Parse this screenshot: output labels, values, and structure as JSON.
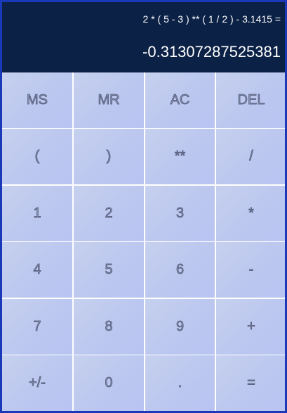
{
  "display": {
    "expression": "2 * ( 5 - 3 ) ** ( 1 / 2 ) - 3.1415 =",
    "result": "-0.31307287525381"
  },
  "keys": [
    {
      "label": "MS",
      "name": "memory-store-button"
    },
    {
      "label": "MR",
      "name": "memory-recall-button"
    },
    {
      "label": "AC",
      "name": "all-clear-button"
    },
    {
      "label": "DEL",
      "name": "delete-button"
    },
    {
      "label": "(",
      "name": "open-paren-button"
    },
    {
      "label": ")",
      "name": "close-paren-button"
    },
    {
      "label": "**",
      "name": "power-button"
    },
    {
      "label": "/",
      "name": "divide-button"
    },
    {
      "label": "1",
      "name": "digit-1-button"
    },
    {
      "label": "2",
      "name": "digit-2-button"
    },
    {
      "label": "3",
      "name": "digit-3-button"
    },
    {
      "label": "*",
      "name": "multiply-button"
    },
    {
      "label": "4",
      "name": "digit-4-button"
    },
    {
      "label": "5",
      "name": "digit-5-button"
    },
    {
      "label": "6",
      "name": "digit-6-button"
    },
    {
      "label": "-",
      "name": "subtract-button"
    },
    {
      "label": "7",
      "name": "digit-7-button"
    },
    {
      "label": "8",
      "name": "digit-8-button"
    },
    {
      "label": "9",
      "name": "digit-9-button"
    },
    {
      "label": "+",
      "name": "add-button"
    },
    {
      "label": "+/-",
      "name": "toggle-sign-button"
    },
    {
      "label": "0",
      "name": "digit-0-button"
    },
    {
      "label": ".",
      "name": "decimal-point-button"
    },
    {
      "label": "=",
      "name": "equals-button"
    }
  ]
}
